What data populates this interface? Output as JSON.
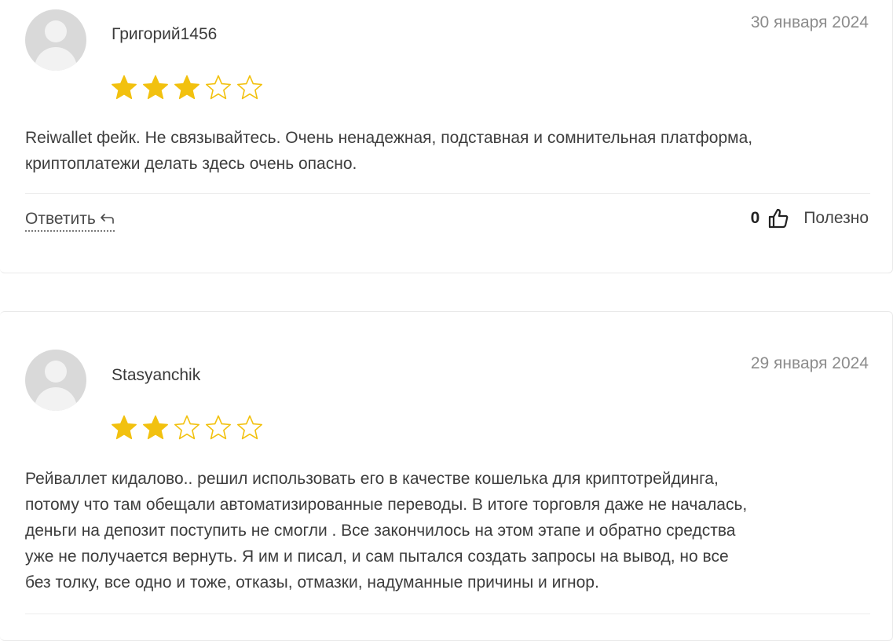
{
  "colors": {
    "star_filled": "#f2c10f",
    "star_empty_stroke": "#f2c10f"
  },
  "reviews": [
    {
      "author": "Григорий1456",
      "date": "30 января 2024",
      "rating": 3,
      "max_rating": 5,
      "text_lines": [
        "Reiwallet фейк. Не связывайтесь. Очень ненадежная, подставная и сомнительная платформа,",
        "криптоплатежи делать здесь очень опасно."
      ],
      "reply_label": "Ответить",
      "likes": "0",
      "helpful_label": "Полезно"
    },
    {
      "author": "Stasyanchik",
      "date": "29 января 2024",
      "rating": 2,
      "max_rating": 5,
      "text_lines": [
        "Рейваллет кидалово.. решил использовать его в качестве кошелька для криптотрейдинга,",
        "потому что там обещали автоматизированные переводы. В итоге торговля даже не началась,",
        "деньги на депозит поступить не смогли . Все закончилось на этом этапе и обратно средства",
        "уже не получается вернуть. Я им и писал, и сам пытался создать запросы на вывод, но все",
        "без толку, все одно и тоже, отказы, отмазки, надуманные причины и игнор."
      ]
    }
  ]
}
